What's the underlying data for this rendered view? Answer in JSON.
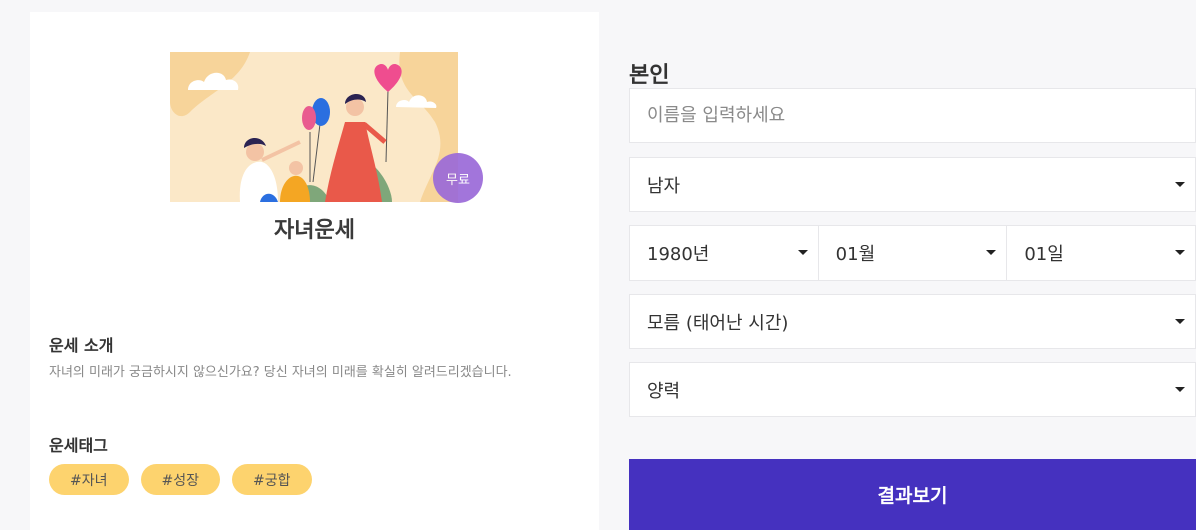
{
  "card": {
    "badge": "무료",
    "title": "자녀운세",
    "intro_heading": "운세 소개",
    "intro_text": "자녀의 미래가 궁금하시지 않으신가요? 당신 자녀의 미래를 확실히 알려드리겠습니다.",
    "tags_heading": "운세태그",
    "tags": [
      "#자녀",
      "#성장",
      "#궁합"
    ]
  },
  "form": {
    "section_label": "본인",
    "name_placeholder": "이름을 입력하세요",
    "gender": "남자",
    "year": "1980년",
    "month": "01월",
    "day": "01일",
    "birth_time": "모름 (태어난 시간)",
    "calendar": "양력",
    "submit_label": "결과보기"
  },
  "colors": {
    "accent": "#4531bf",
    "badge": "#9b6ad8",
    "tag": "#fdd36e"
  }
}
